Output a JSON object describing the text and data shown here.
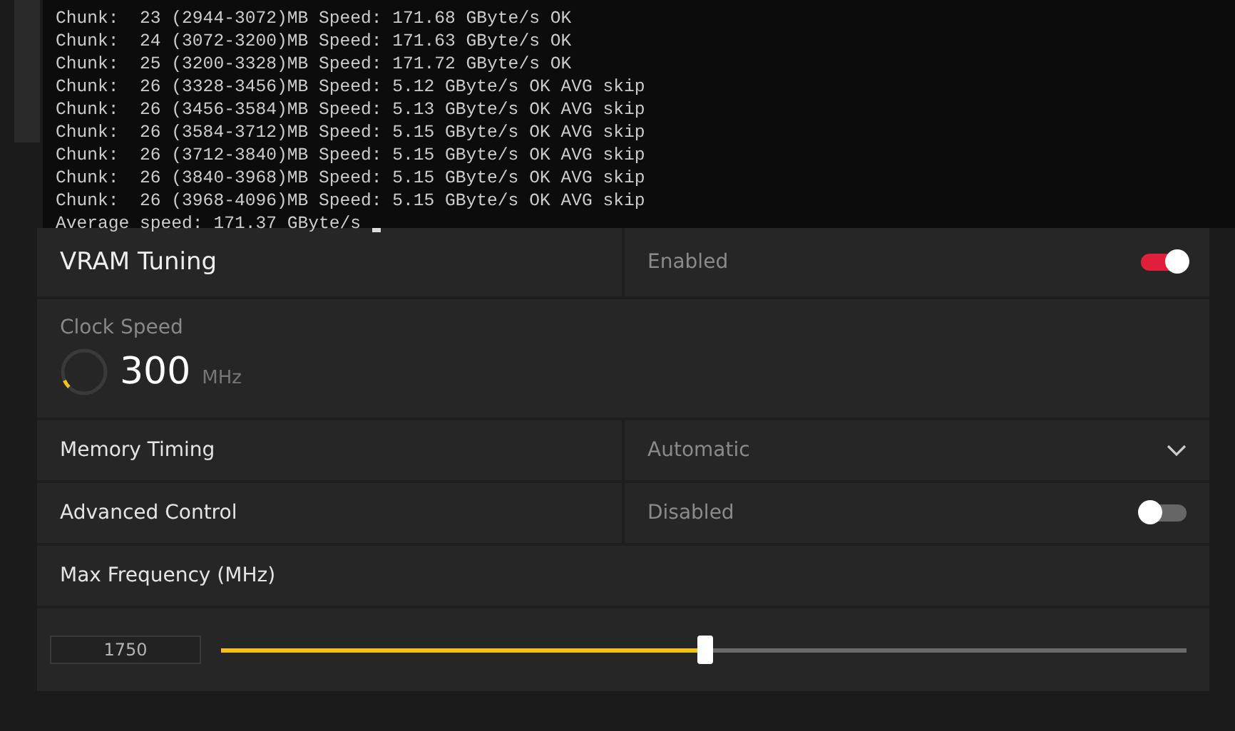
{
  "terminal": {
    "lines": [
      "Chunk:  23 (2944-3072)MB Speed: 171.68 GByte/s OK",
      "Chunk:  24 (3072-3200)MB Speed: 171.63 GByte/s OK",
      "Chunk:  25 (3200-3328)MB Speed: 171.72 GByte/s OK",
      "Chunk:  26 (3328-3456)MB Speed: 5.12 GByte/s OK AVG skip",
      "Chunk:  26 (3456-3584)MB Speed: 5.13 GByte/s OK AVG skip",
      "Chunk:  26 (3584-3712)MB Speed: 5.15 GByte/s OK AVG skip",
      "Chunk:  26 (3712-3840)MB Speed: 5.15 GByte/s OK AVG skip",
      "Chunk:  26 (3840-3968)MB Speed: 5.15 GByte/s OK AVG skip",
      "Chunk:  26 (3968-4096)MB Speed: 5.15 GByte/s OK AVG skip",
      "Average speed: 171.37 GByte/s"
    ]
  },
  "panel": {
    "title": "VRAM Tuning",
    "title_state": "Enabled",
    "on": true,
    "clock": {
      "label": "Clock Speed",
      "value": "300",
      "unit": "MHz",
      "level": 0.06
    },
    "rows": [
      {
        "kind": "dropdown",
        "label": "Memory Timing",
        "value": "Automatic"
      },
      {
        "kind": "toggle",
        "label": "Advanced Control",
        "value": "Disabled",
        "on": false
      }
    ],
    "max_frequency": {
      "label": "Max Frequency (MHz)",
      "value": "1750",
      "level": 0.5
    }
  }
}
